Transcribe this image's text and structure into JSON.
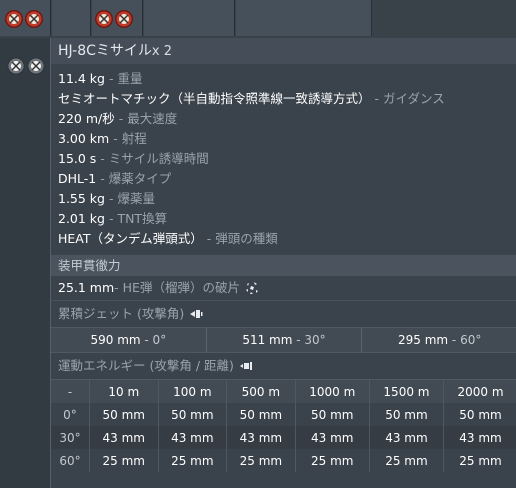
{
  "title": {
    "name": "HJ-8Cミサイル",
    "count": "x 2"
  },
  "stats": [
    {
      "value": "11.4 kg",
      "label": " - 重量"
    },
    {
      "value": "セミオートマチック（半自動指令照準線一致誘導方式）",
      "label": " - ガイダンス"
    },
    {
      "value": "220 m/秒",
      "label": " - 最大速度"
    },
    {
      "value": "3.00 km",
      "label": " - 射程"
    },
    {
      "value": "15.0 s",
      "label": " - ミサイル誘導時間"
    },
    {
      "value": "DHL-1",
      "label": " - 爆薬タイプ"
    },
    {
      "value": "1.55 kg",
      "label": " - 爆薬量"
    },
    {
      "value": "2.01 kg",
      "label": " - TNT換算"
    },
    {
      "value": "HEAT（タンデム弾頭式）",
      "label": " - 弾頭の種類"
    }
  ],
  "armor": {
    "section_title": "装甲貫徹力",
    "fragment": {
      "value": "25.1 mm",
      "label": " - HE弾（榴弾）の破片"
    },
    "cumulative": {
      "title": "累積ジェット (攻撃角)",
      "entries": [
        {
          "value": "590 mm",
          "angle": " - 0°"
        },
        {
          "value": "511 mm",
          "angle": " - 30°"
        },
        {
          "value": "295 mm",
          "angle": " - 60°"
        }
      ]
    },
    "kinetic": {
      "title": "運動エネルギー (攻撃角 / 距離)",
      "header": [
        "-",
        "10 m",
        "100 m",
        "500 m",
        "1000 m",
        "1500 m",
        "2000 m"
      ],
      "rows": [
        [
          "0°",
          "50 mm",
          "50 mm",
          "50 mm",
          "50 mm",
          "50 mm",
          "50 mm"
        ],
        [
          "30°",
          "43 mm",
          "43 mm",
          "43 mm",
          "43 mm",
          "43 mm",
          "43 mm"
        ],
        [
          "60°",
          "25 mm",
          "25 mm",
          "25 mm",
          "25 mm",
          "25 mm",
          "25 mm"
        ]
      ]
    }
  },
  "colors": {
    "accent_red": "#c23a2a",
    "panel_bg": "#3a424b",
    "label_grey": "#9aa3ab"
  }
}
